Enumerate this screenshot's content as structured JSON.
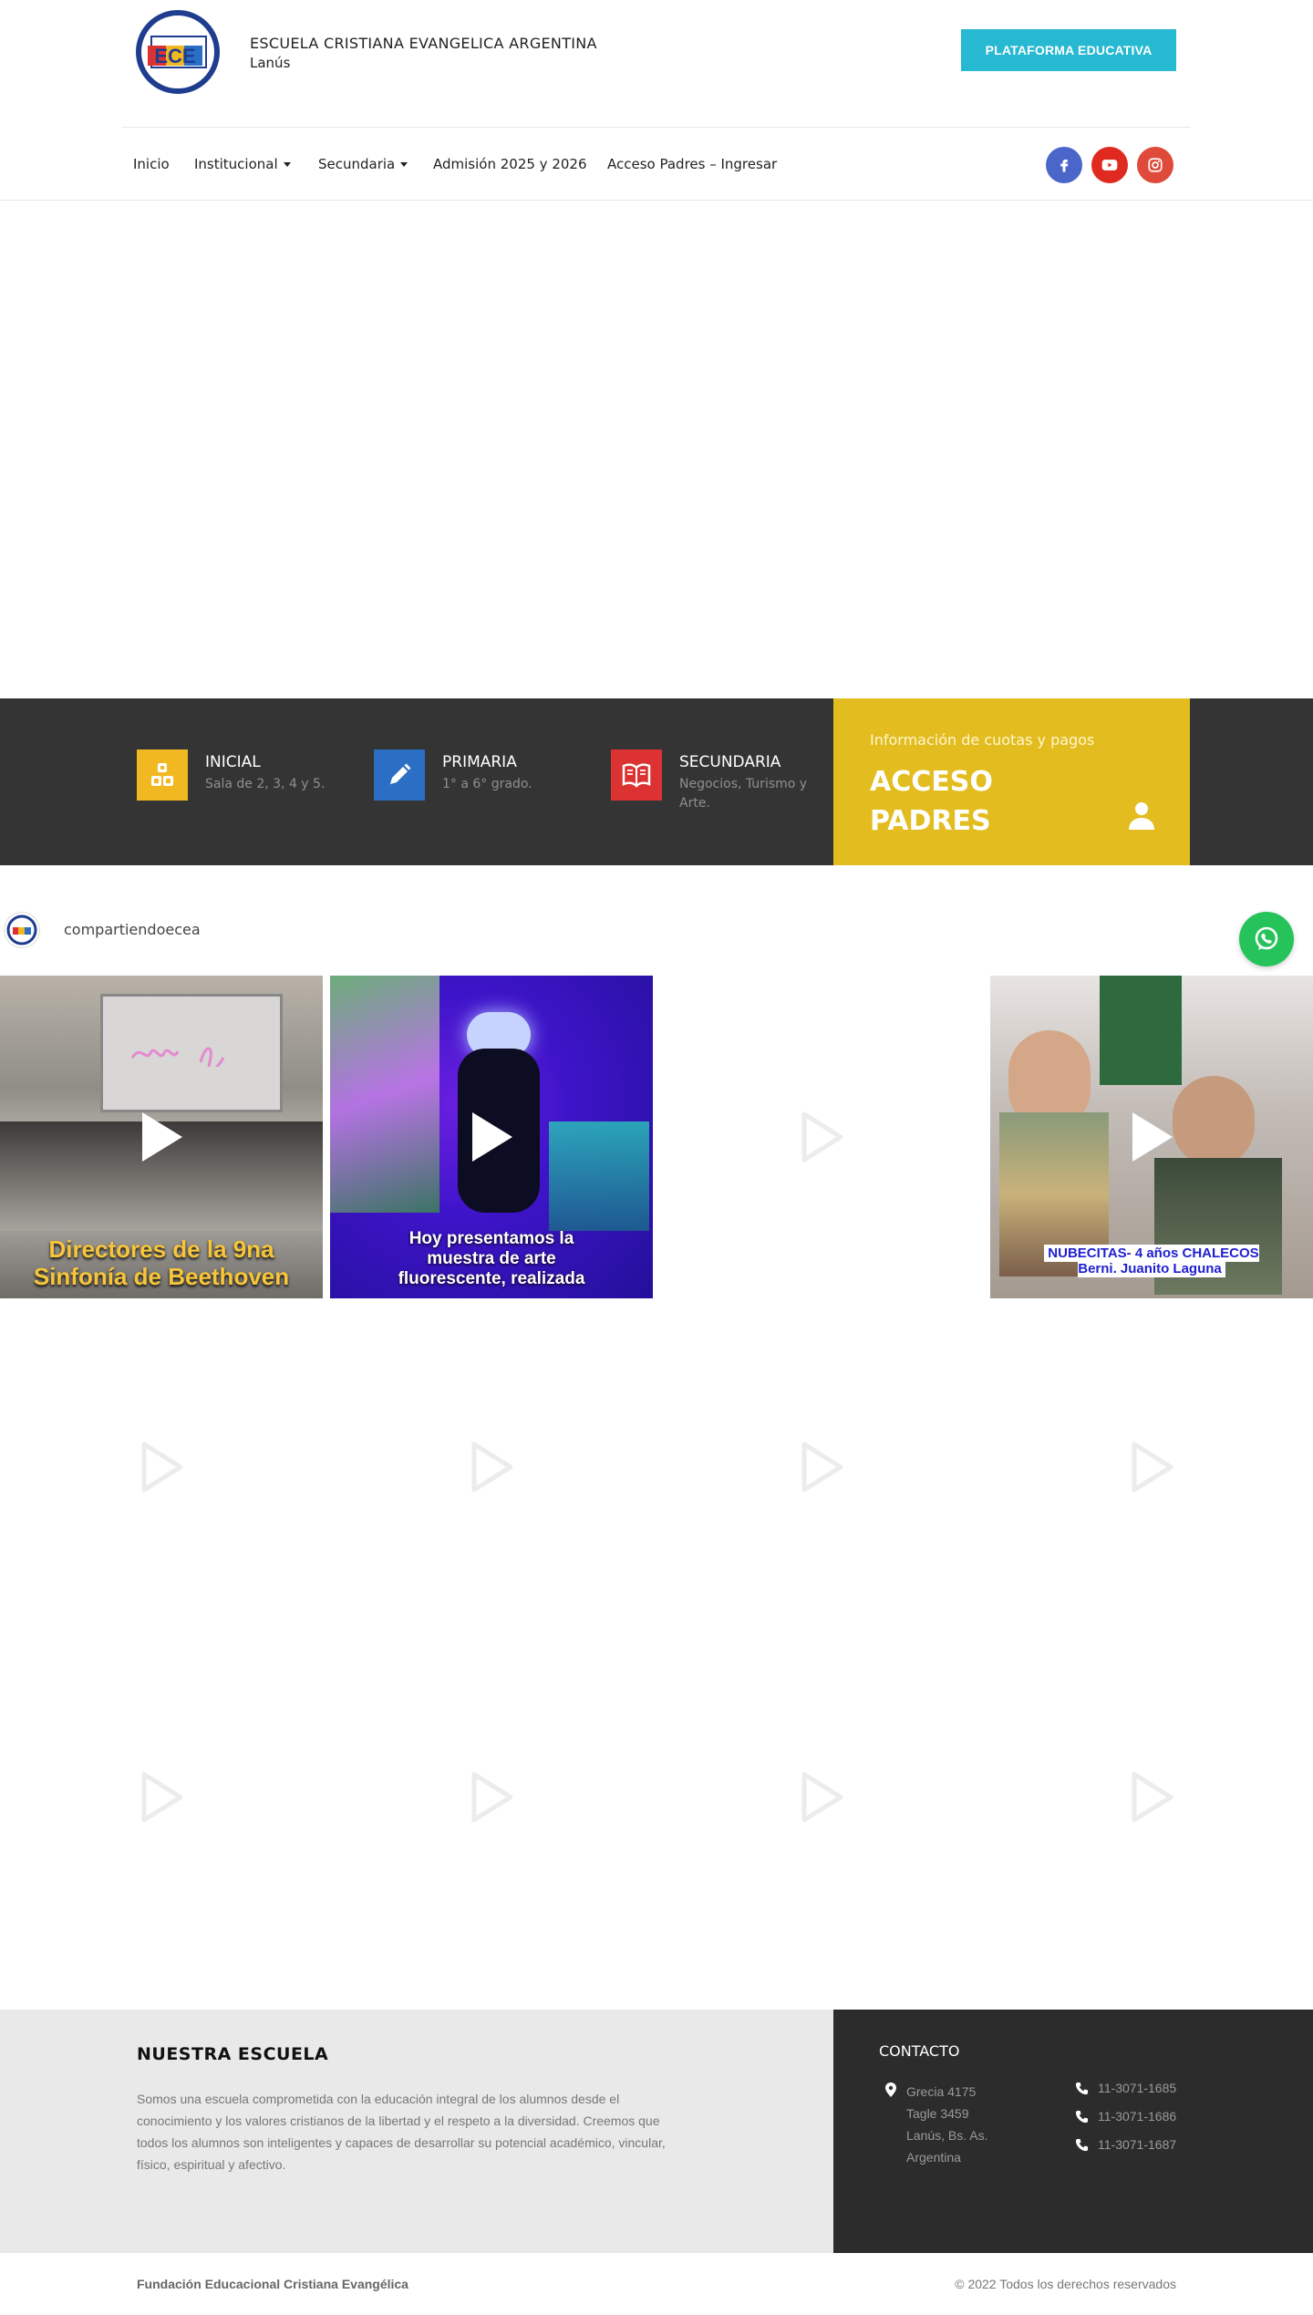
{
  "header": {
    "school_name": "ESCUELA CRISTIANA EVANGELICA ARGENTINA",
    "city": "Lanús",
    "logo_text": "ECE",
    "platform_button": "PLATAFORMA EDUCATIVA"
  },
  "nav": {
    "items": [
      {
        "label": "Inicio",
        "dropdown": false
      },
      {
        "label": "Institucional",
        "dropdown": true
      },
      {
        "label": "Secundaria",
        "dropdown": true
      },
      {
        "label": "Admisión 2025 y 2026",
        "dropdown": false
      },
      {
        "label": "Acceso Padres – Ingresar",
        "dropdown": false
      }
    ],
    "social": [
      {
        "icon": "facebook-icon",
        "color": "#4a66c9"
      },
      {
        "icon": "youtube-icon",
        "color": "#e02a20"
      },
      {
        "icon": "instagram-icon",
        "color": "#e04a3a"
      }
    ]
  },
  "levels": [
    {
      "title": "INICIAL",
      "desc": "Sala de 2, 3, 4 y 5.",
      "icon": "blocks-icon",
      "color": "#f2b822"
    },
    {
      "title": "PRIMARIA",
      "desc": "1° a 6° grado.",
      "icon": "pencil-icon",
      "color": "#2a6fc4"
    },
    {
      "title": "SECUNDARIA",
      "desc": "Negocios, Turismo y Arte.",
      "icon": "book-icon",
      "color": "#dc3232"
    }
  ],
  "padres": {
    "small": "Información de cuotas y pagos",
    "big": "ACCESO PADRES",
    "icon": "user-icon",
    "color": "#e3bd1f"
  },
  "instagram": {
    "username": "compartiendoecea",
    "posts": [
      {
        "caption": "Directores de la 9na Sinfonía de Beethoven"
      },
      {
        "caption": "Hoy presentamos la muestra de arte fluorescente, realizada"
      },
      {
        "caption": ""
      },
      {
        "caption": "NUBECITAS- 4 años CHALECOS Berni. Juanito Laguna"
      }
    ]
  },
  "footer": {
    "title": "NUESTRA ESCUELA",
    "text": "Somos una escuela comprometida con la educación integral de los alumnos desde el conocimiento y los valores cristianos de la libertad y el respeto a la diversidad. Creemos que todos los alumnos son inteligentes y capaces de desarrollar su potencial académico, vincular, físico, espiritual y afectivo.",
    "contact_title": "CONTACTO",
    "address": [
      "Grecia 4175",
      "Tagle 3459",
      "Lanús, Bs. As.",
      "Argentina"
    ],
    "phones": [
      "11-3071-1685",
      "11-3071-1686",
      "11-3071-1687"
    ]
  },
  "bottom": {
    "left": "Fundación Educacional Cristiana Evangélica",
    "right": "© 2022 Todos los derechos reservados"
  }
}
